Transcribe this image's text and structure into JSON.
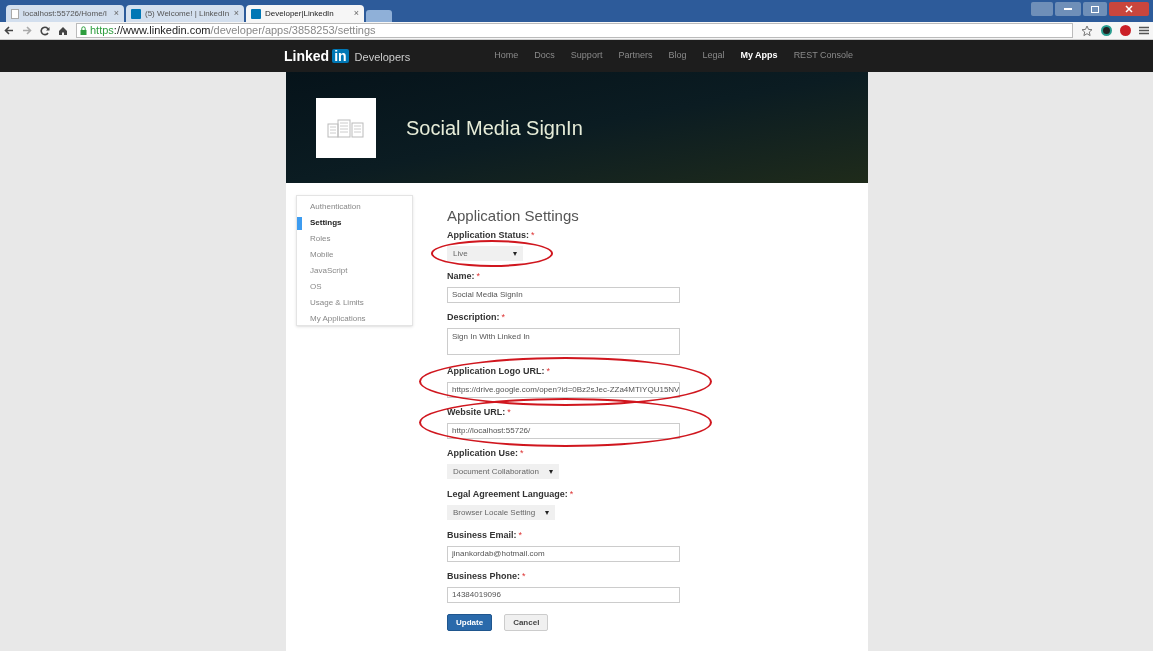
{
  "browser": {
    "tabs": [
      {
        "title": "localhost:55726/Home/I",
        "selected": false
      },
      {
        "title": "(5) Welcome! | LinkedIn",
        "selected": false
      },
      {
        "title": "Developer|LinkedIn",
        "selected": true
      }
    ],
    "close_glyph": "×",
    "url": {
      "scheme": "https",
      "domain": "://www.linkedin.com",
      "path": "/developer/apps/3858253/settings"
    }
  },
  "navbar": {
    "logo": {
      "word": "Linked",
      "badge": "in",
      "suffix": "Developers"
    },
    "links": [
      {
        "label": "Home",
        "selected": false
      },
      {
        "label": "Docs",
        "selected": false
      },
      {
        "label": "Support",
        "selected": false
      },
      {
        "label": "Partners",
        "selected": false
      },
      {
        "label": "Blog",
        "selected": false
      },
      {
        "label": "Legal",
        "selected": false
      },
      {
        "label": "My Apps",
        "selected": true
      },
      {
        "label": "REST Console",
        "selected": false
      }
    ]
  },
  "banner": {
    "app_name": "Social Media SignIn"
  },
  "sidebar": {
    "items": [
      {
        "label": "Authentication",
        "selected": false
      },
      {
        "label": "Settings",
        "selected": true
      },
      {
        "label": "Roles",
        "selected": false
      },
      {
        "label": "Mobile",
        "selected": false
      },
      {
        "label": "JavaScript",
        "selected": false
      },
      {
        "label": "OS",
        "selected": false
      },
      {
        "label": "Usage & Limits",
        "selected": false
      },
      {
        "label": "My Applications",
        "selected": false
      }
    ]
  },
  "form": {
    "title": "Application Settings",
    "required_mark": "*",
    "fields": [
      {
        "kind": "select",
        "label": "Application Status:",
        "value": "Live",
        "circled": true
      },
      {
        "kind": "text",
        "label": "Name:",
        "value": "Social Media SignIn",
        "circled": false
      },
      {
        "kind": "textarea",
        "label": "Description:",
        "value": "Sign In With Linked In",
        "circled": false
      },
      {
        "kind": "text",
        "label": "Application Logo URL:",
        "value": "https://drive.google.com/open?id=0Bz2sJec-ZZa4MTIYQU15NV",
        "circled": true
      },
      {
        "kind": "text",
        "label": "Website URL:",
        "value": "http://localhost:55726/",
        "circled": true
      },
      {
        "kind": "select",
        "label": "Application Use:",
        "value": "Document Collaboration",
        "circled": false
      },
      {
        "kind": "select",
        "label": "Legal Agreement Language:",
        "value": "Browser Locale Setting",
        "circled": false
      },
      {
        "kind": "text",
        "label": "Business Email:",
        "value": "jinankordab@hotmail.com",
        "circled": false
      },
      {
        "kind": "text",
        "label": "Business Phone:",
        "value": "14384019096",
        "circled": false
      }
    ],
    "buttons": [
      {
        "label": "Update",
        "kind": "primary"
      },
      {
        "label": "Cancel",
        "kind": "secondary"
      }
    ]
  }
}
